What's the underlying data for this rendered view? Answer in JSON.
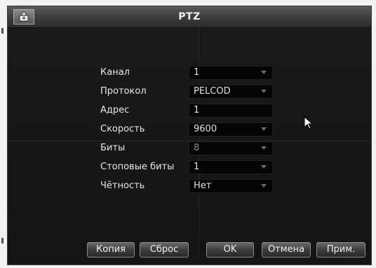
{
  "window": {
    "title": "PTZ",
    "icon": "ptz-camera-icon"
  },
  "form": {
    "rows": [
      {
        "label": "Канал",
        "value": "1",
        "type": "dropdown",
        "dim": false
      },
      {
        "label": "Протокол",
        "value": "PELCOD",
        "type": "dropdown",
        "dim": false
      },
      {
        "label": "Адрес",
        "value": "1",
        "type": "input",
        "dim": false
      },
      {
        "label": "Скорость",
        "value": "9600",
        "type": "dropdown",
        "dim": false
      },
      {
        "label": "Биты",
        "value": "8",
        "type": "dropdown",
        "dim": true
      },
      {
        "label": "Стоповые биты",
        "value": "1",
        "type": "dropdown",
        "dim": false
      },
      {
        "label": "Чётность",
        "value": "Нет",
        "type": "dropdown",
        "dim": false
      }
    ]
  },
  "buttons": {
    "copy": "Копия",
    "reset": "Сброс",
    "ok": "OK",
    "cancel": "Отмена",
    "apply": "Прим."
  },
  "colors": {
    "background": "#141414",
    "field": "#050505",
    "text": "#e8e8e8"
  }
}
